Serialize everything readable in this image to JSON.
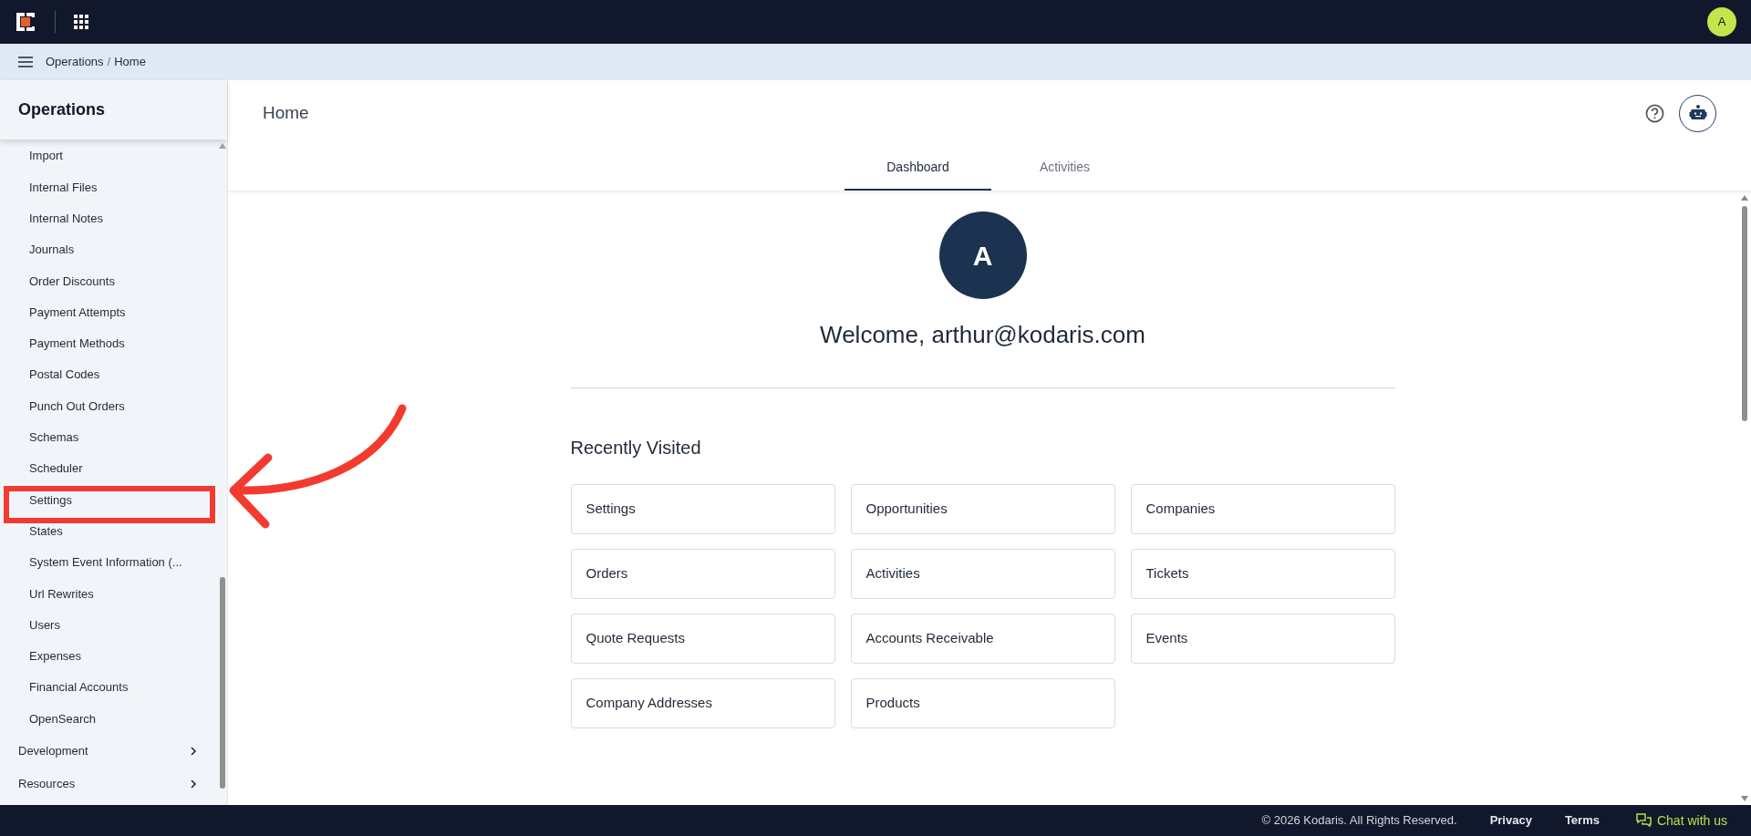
{
  "top_bar": {
    "user_initial": "A"
  },
  "breadcrumb": {
    "items": [
      "Operations",
      "Home"
    ],
    "separator": "/"
  },
  "sidebar": {
    "title": "Operations",
    "items": [
      {
        "label": "Import",
        "highlighted": false
      },
      {
        "label": "Internal Files",
        "highlighted": false
      },
      {
        "label": "Internal Notes",
        "highlighted": false
      },
      {
        "label": "Journals",
        "highlighted": false
      },
      {
        "label": "Order Discounts",
        "highlighted": false
      },
      {
        "label": "Payment Attempts",
        "highlighted": false
      },
      {
        "label": "Payment Methods",
        "highlighted": false
      },
      {
        "label": "Postal Codes",
        "highlighted": false
      },
      {
        "label": "Punch Out Orders",
        "highlighted": false
      },
      {
        "label": "Schemas",
        "highlighted": false
      },
      {
        "label": "Scheduler",
        "highlighted": false
      },
      {
        "label": "Settings",
        "highlighted": true
      },
      {
        "label": "States",
        "highlighted": false
      },
      {
        "label": "System Event Information (...",
        "highlighted": false
      },
      {
        "label": "Url Rewrites",
        "highlighted": false
      },
      {
        "label": "Users",
        "highlighted": false
      },
      {
        "label": "Expenses",
        "highlighted": false
      },
      {
        "label": "Financial Accounts",
        "highlighted": false
      },
      {
        "label": "OpenSearch",
        "highlighted": false
      }
    ],
    "groups": [
      {
        "label": "Development",
        "expanded": false
      },
      {
        "label": "Resources",
        "expanded": false
      }
    ]
  },
  "page": {
    "title": "Home",
    "tabs": [
      {
        "label": "Dashboard",
        "selected": true
      },
      {
        "label": "Activities",
        "selected": false
      }
    ],
    "avatar_initial": "A",
    "welcome": "Welcome, arthur@kodaris.com",
    "recently_visited": {
      "title": "Recently Visited",
      "links": [
        "Settings",
        "Opportunities",
        "Companies",
        "Orders",
        "Activities",
        "Tickets",
        "Quote Requests",
        "Accounts Receivable",
        "Events",
        "Company Addresses",
        "Products"
      ]
    }
  },
  "footer": {
    "copyright": "© 2026 Kodaris. All Rights Reserved.",
    "links": [
      "Privacy",
      "Terms"
    ],
    "chat": "Chat with us"
  }
}
